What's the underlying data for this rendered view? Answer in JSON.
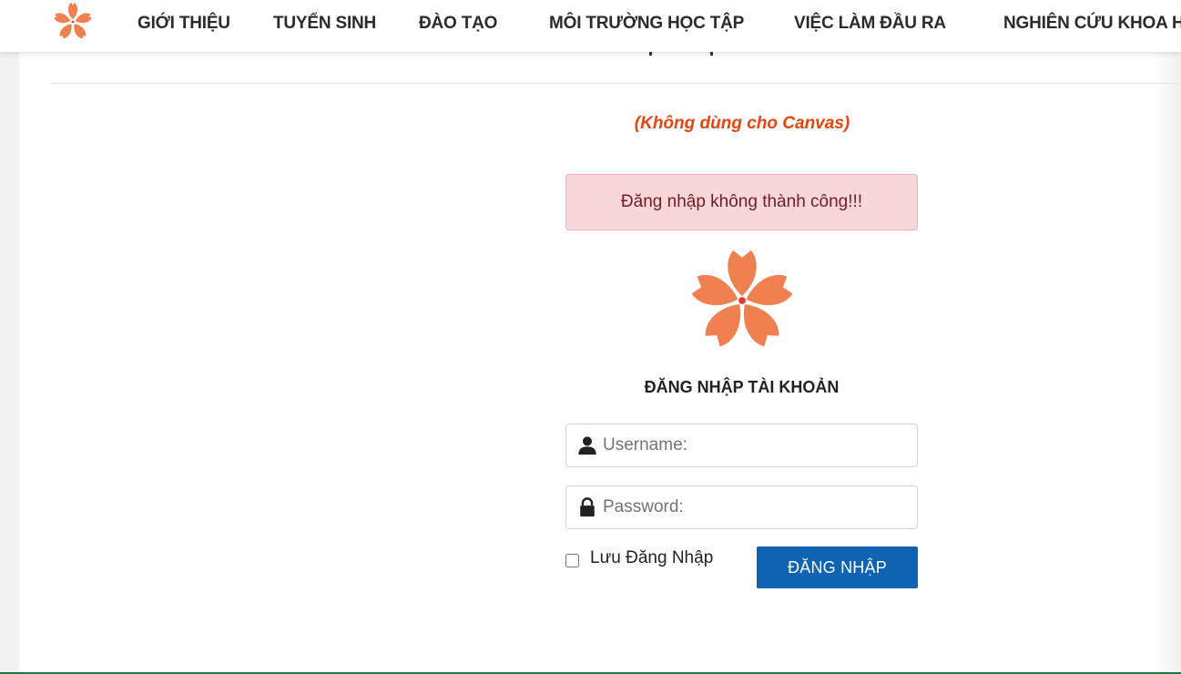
{
  "nav": {
    "items": [
      {
        "label": "GIỚI THIỆU"
      },
      {
        "label": "TUYỂN SINH"
      },
      {
        "label": "ĐÀO TẠO"
      },
      {
        "label": "MÔI TRƯỜNG HỌC TẬP"
      },
      {
        "label": "VIỆC LÀM ĐẦU RA"
      },
      {
        "label": "NGHIÊN CỨU KHOA HỌC"
      }
    ]
  },
  "login": {
    "notice": "(Không dùng cho Canvas)",
    "error_message": "Đăng nhập không thành công!!!",
    "title": "ĐĂNG NHẬP TÀI KHOẢN",
    "username_placeholder": "Username:",
    "username_value": "",
    "password_placeholder": "Password:",
    "password_value": "",
    "remember_label": "Lưu Đăng Nhập",
    "remember_checked": false,
    "submit_label": "ĐĂNG NHẬP"
  },
  "colors": {
    "brand_orange": "#f08050",
    "notice_red": "#e8450e",
    "button_blue": "#0f63b2",
    "alert_bg": "#f8d7da",
    "alert_text": "#721c24"
  },
  "icons": {
    "logo": "flower-logo-icon",
    "username": "user-icon",
    "password": "lock-icon"
  }
}
